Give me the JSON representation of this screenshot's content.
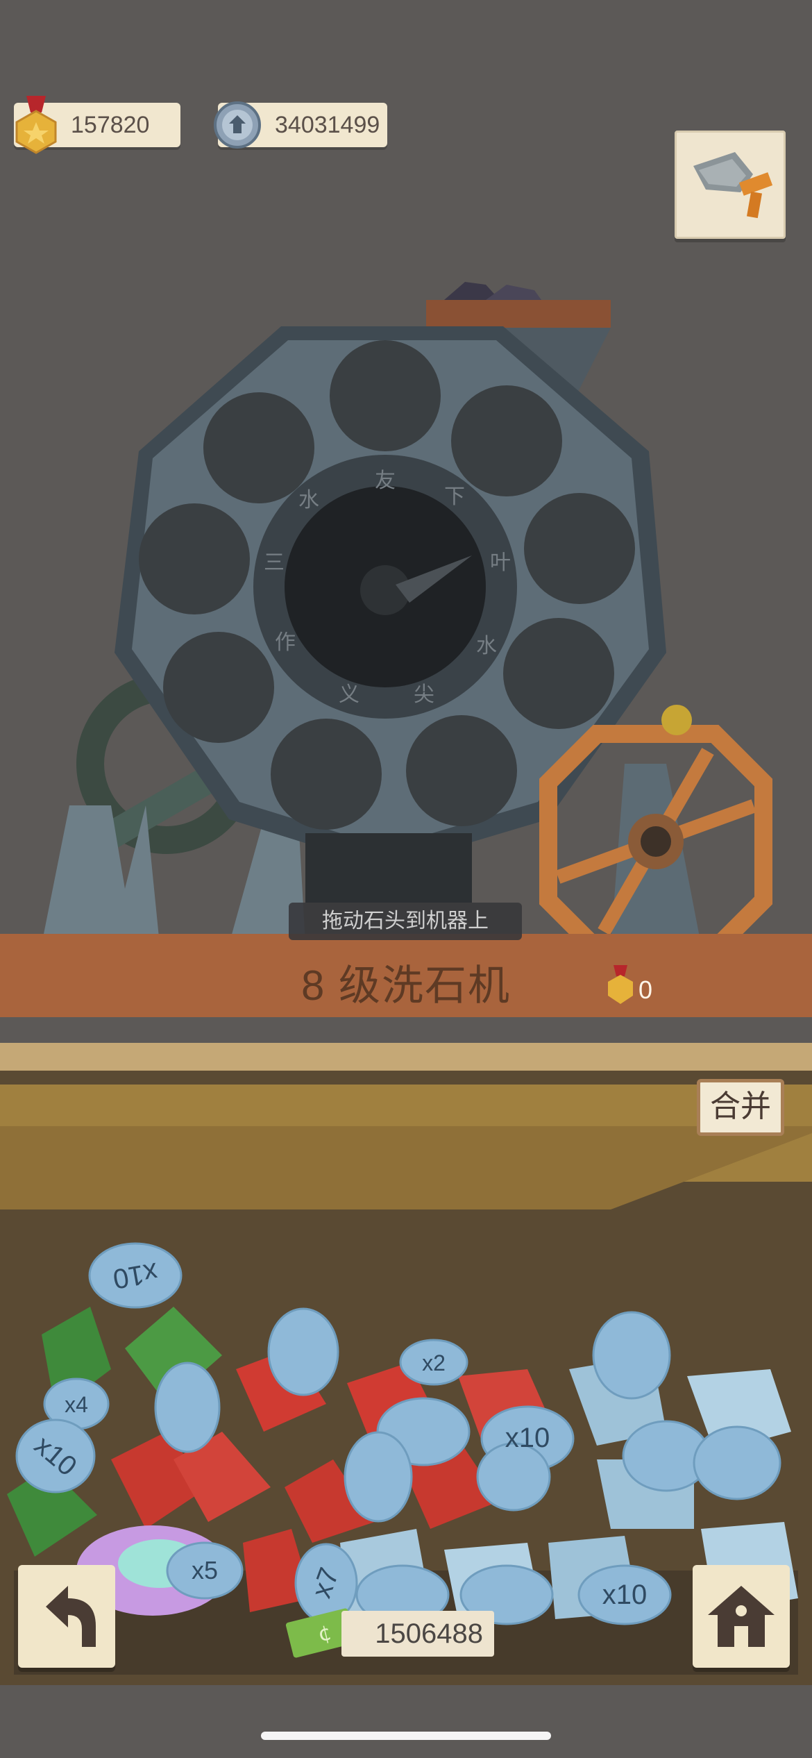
{
  "currencies": {
    "medals": "157820",
    "coins": "34031499"
  },
  "machine": {
    "hint": "拖动石头到机器上",
    "title": "8 级洗石机",
    "medal_count": "0",
    "dial_runes": [
      "友",
      "下",
      "叶",
      "水",
      "尖",
      "义",
      "作",
      "三",
      "水"
    ]
  },
  "bin": {
    "merge_label": "合并",
    "cash": "1506488",
    "gems": [
      {
        "kind": "ruby",
        "label": "x10"
      },
      {
        "kind": "ruby",
        "label": "x2"
      },
      {
        "kind": "diamond",
        "label": "x10"
      },
      {
        "kind": "emerald",
        "label": "x4"
      },
      {
        "kind": "emerald",
        "label": "x10"
      },
      {
        "kind": "diamond",
        "label": "x10"
      },
      {
        "kind": "diamond",
        "label": "x7"
      },
      {
        "kind": "opal",
        "label": "x5"
      }
    ]
  },
  "icons": {
    "back": "back-arrow-icon",
    "home": "home-icon",
    "medal": "medal-icon",
    "coin": "coin-icon",
    "tool": "crowbar-tool-icon",
    "cash": "cash-icon"
  }
}
